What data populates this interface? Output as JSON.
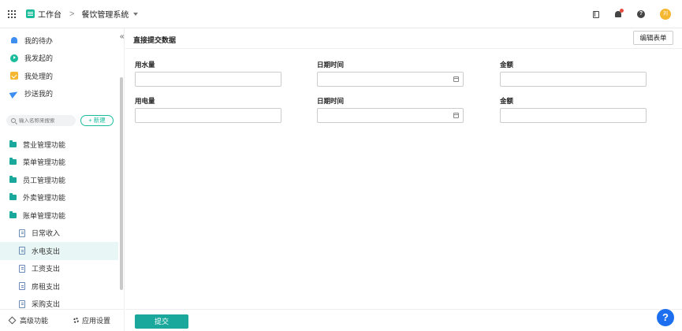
{
  "topbar": {
    "workspace": "工作台",
    "separator": ">",
    "system_name": "餐饮管理系统",
    "avatar_text": "刘"
  },
  "sidebar": {
    "nav": [
      {
        "label": "我的待办",
        "icon": "bell-icon"
      },
      {
        "label": "我发起的",
        "icon": "play-icon"
      },
      {
        "label": "我处理的",
        "icon": "check-icon"
      },
      {
        "label": "抄送我的",
        "icon": "send-icon"
      }
    ],
    "search_placeholder": "输入名称来搜索",
    "new_button": "+ 新建",
    "folders": [
      {
        "label": "营业管理功能"
      },
      {
        "label": "菜单管理功能"
      },
      {
        "label": "员工管理功能"
      },
      {
        "label": "外卖管理功能"
      },
      {
        "label": "账单管理功能"
      }
    ],
    "files": [
      {
        "label": "日常收入",
        "active": false
      },
      {
        "label": "水电支出",
        "active": true
      },
      {
        "label": "工资支出",
        "active": false
      },
      {
        "label": "房租支出",
        "active": false
      },
      {
        "label": "采购支出",
        "active": false
      }
    ],
    "footer": {
      "advanced": "高级功能",
      "settings": "应用设置"
    }
  },
  "main": {
    "title": "直接提交数据",
    "edit_button": "编辑表单",
    "rows": [
      [
        {
          "label": "用水量",
          "type": "text"
        },
        {
          "label": "日期时间",
          "type": "date"
        },
        {
          "label": "金额",
          "type": "text"
        }
      ],
      [
        {
          "label": "用电量",
          "type": "text"
        },
        {
          "label": "日期时间",
          "type": "date"
        },
        {
          "label": "金额",
          "type": "text"
        }
      ]
    ],
    "submit_button": "提交",
    "help_fab": "?"
  },
  "colors": {
    "accent": "#1aa89c",
    "active_row": "#e8f7f5",
    "help_fab": "#1e6ff0",
    "avatar": "#f5b731"
  }
}
